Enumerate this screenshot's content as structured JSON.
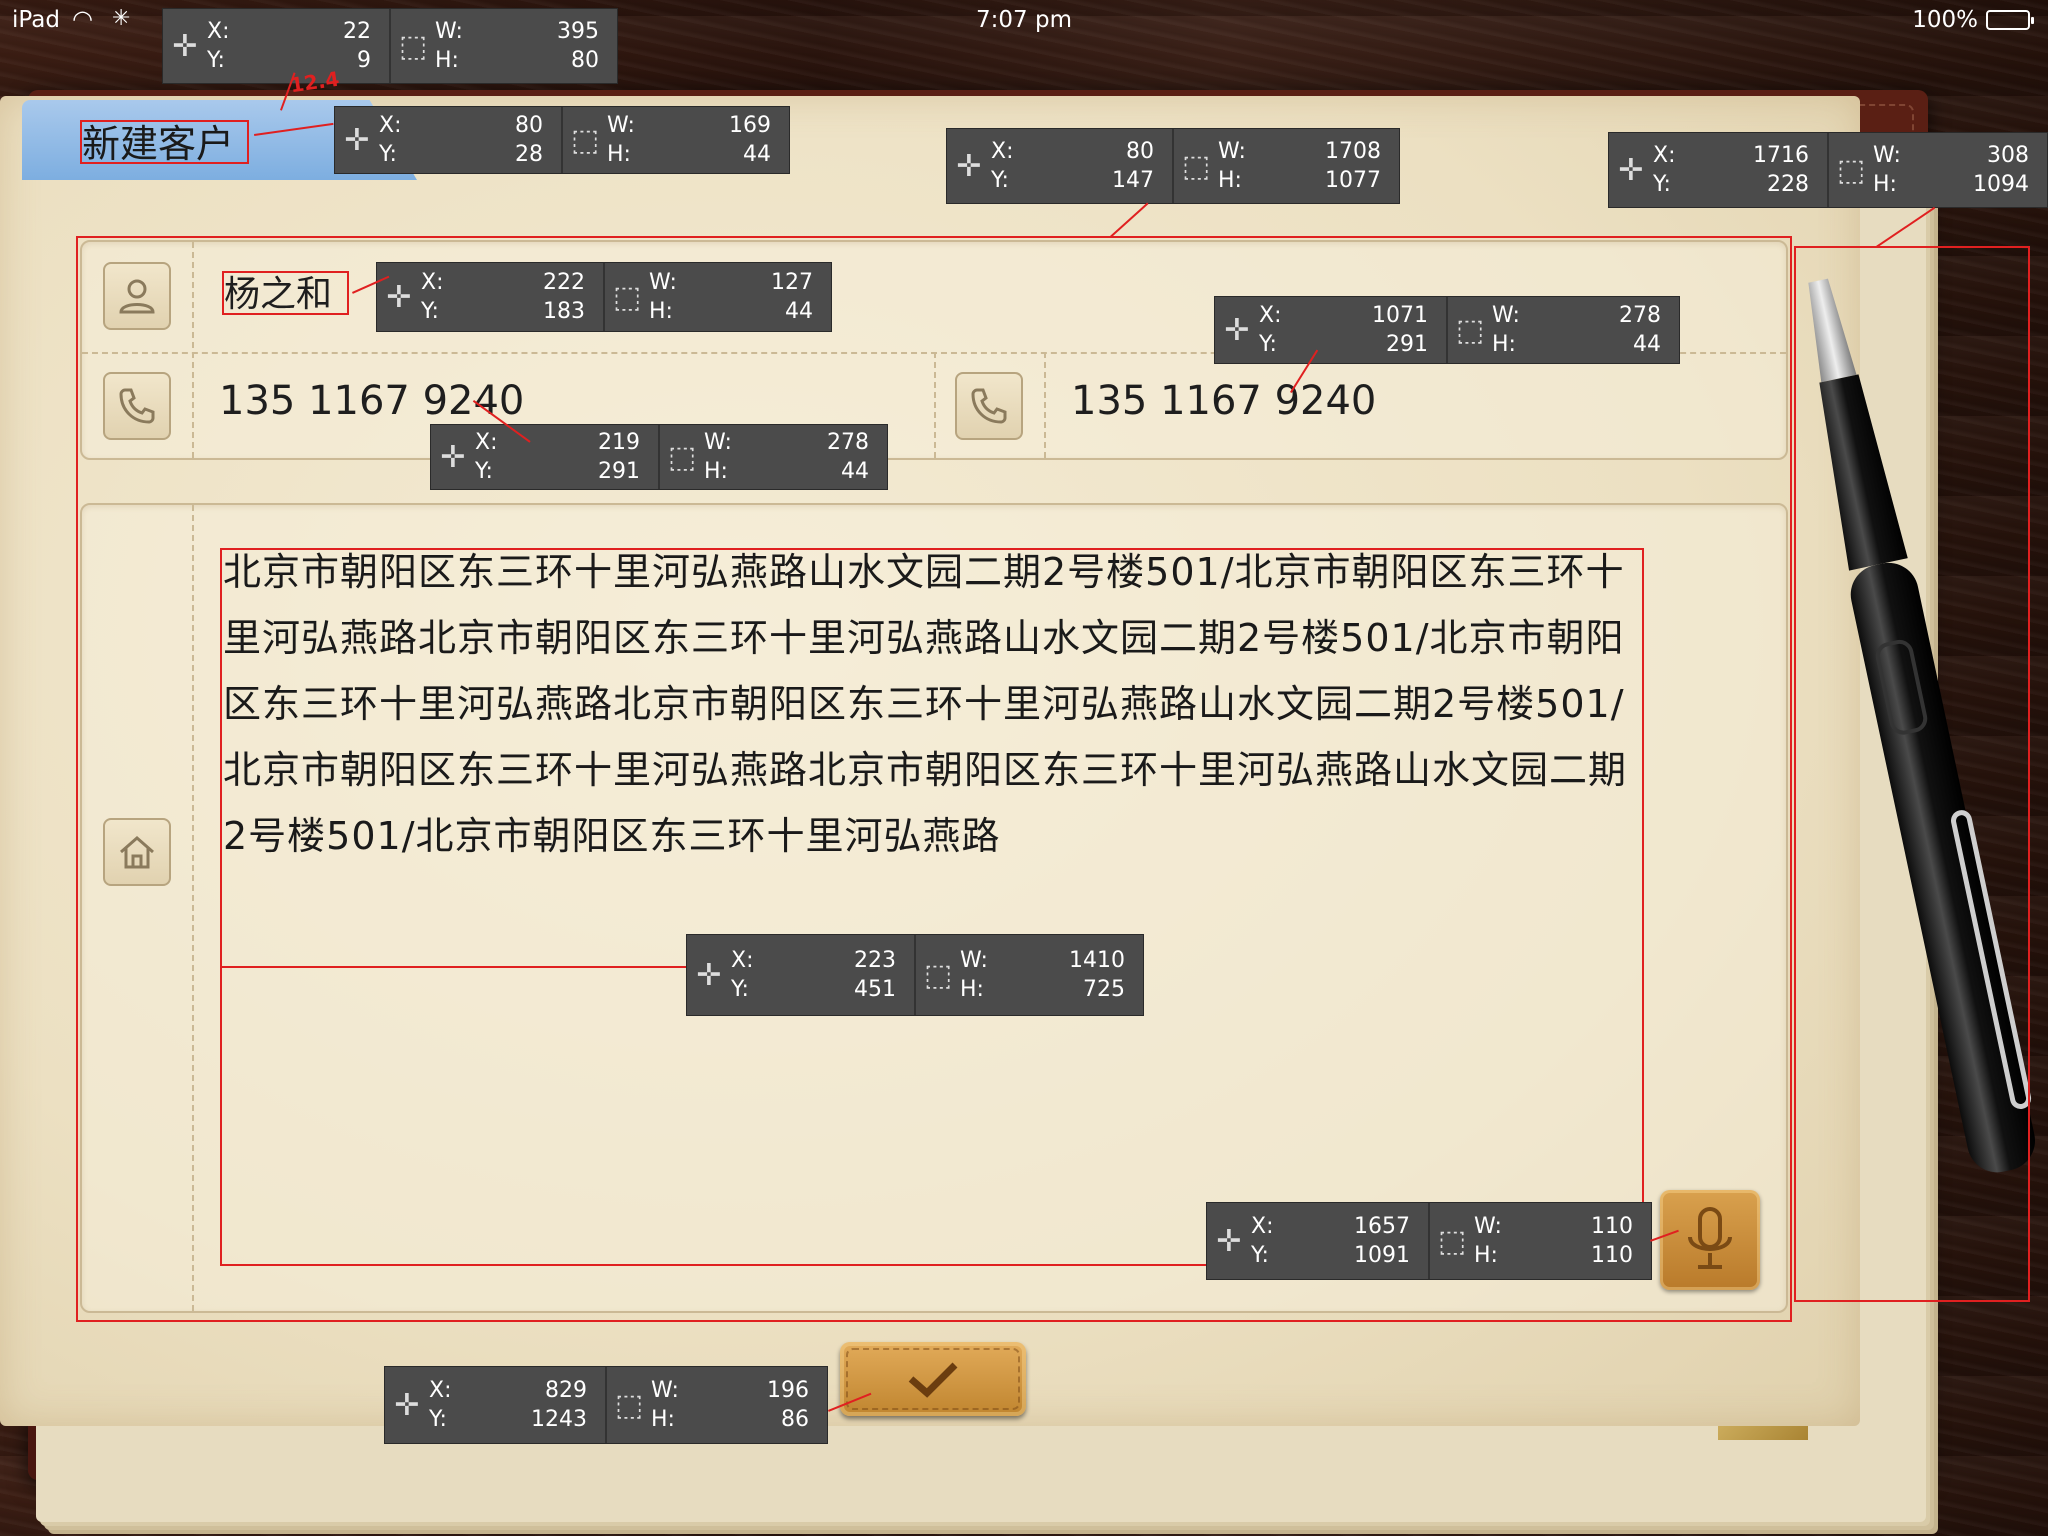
{
  "status_bar": {
    "carrier": "iPad",
    "time": "7:07 pm",
    "battery": "100%",
    "battery_level": 1.0
  },
  "tab": {
    "title": "新建客户"
  },
  "contact": {
    "name": "杨之和",
    "phone_primary": "135 1167 9240",
    "phone_secondary": "135 1167 9240",
    "address": "北京市朝阳区东三环十里河弘燕路山水文园二期2号楼501/北京市朝阳区东三环十里河弘燕路北京市朝阳区东三环十里河弘燕路山水文园二期2号楼501/北京市朝阳区东三环十里河弘燕路北京市朝阳区东三环十里河弘燕路山水文园二期2号楼501/北京市朝阳区东三环十里河弘燕路北京市朝阳区东三环十里河弘燕路山水文园二期2号楼501/北京市朝阳区东三环十里河弘燕路"
  },
  "icons": {
    "person": "person-icon",
    "phone": "phone-icon",
    "home": "home-icon",
    "mic": "microphone-icon",
    "check": "checkmark-icon"
  },
  "measurements": [
    {
      "x_label": "X:",
      "x": "22",
      "y_label": "Y:",
      "y": "9",
      "w_label": "W:",
      "w": "395",
      "h_label": "H:",
      "h": "80"
    },
    {
      "x_label": "X:",
      "x": "80",
      "y_label": "Y:",
      "y": "28",
      "w_label": "W:",
      "w": "169",
      "h_label": "H:",
      "h": "44"
    },
    {
      "x_label": "X:",
      "x": "80",
      "y_label": "Y:",
      "y": "147",
      "w_label": "W:",
      "w": "1708",
      "h_label": "H:",
      "h": "1077"
    },
    {
      "x_label": "X:",
      "x": "1716",
      "y_label": "Y:",
      "y": "228",
      "w_label": "W:",
      "w": "308",
      "h_label": "H:",
      "h": "1094"
    },
    {
      "x_label": "X:",
      "x": "222",
      "y_label": "Y:",
      "y": "183",
      "w_label": "W:",
      "w": "127",
      "h_label": "H:",
      "h": "44"
    },
    {
      "x_label": "X:",
      "x": "1071",
      "y_label": "Y:",
      "y": "291",
      "w_label": "W:",
      "w": "278",
      "h_label": "H:",
      "h": "44"
    },
    {
      "x_label": "X:",
      "x": "219",
      "y_label": "Y:",
      "y": "291",
      "w_label": "W:",
      "w": "278",
      "h_label": "H:",
      "h": "44"
    },
    {
      "x_label": "X:",
      "x": "223",
      "y_label": "Y:",
      "y": "451",
      "w_label": "W:",
      "w": "1410",
      "h_label": "H:",
      "h": "725"
    },
    {
      "x_label": "X:",
      "x": "1657",
      "y_label": "Y:",
      "y": "1091",
      "w_label": "W:",
      "w": "110",
      "h_label": "H:",
      "h": "110"
    },
    {
      "x_label": "X:",
      "x": "829",
      "y_label": "Y:",
      "y": "1243",
      "w_label": "W:",
      "w": "196",
      "h_label": "H:",
      "h": "86"
    }
  ],
  "annotation_note": "12.4",
  "colors": {
    "guide": "#e02020",
    "tab": "#7daee0",
    "button": "#c0852f",
    "page": "#f1e7cd",
    "leather": "#4a1710"
  }
}
